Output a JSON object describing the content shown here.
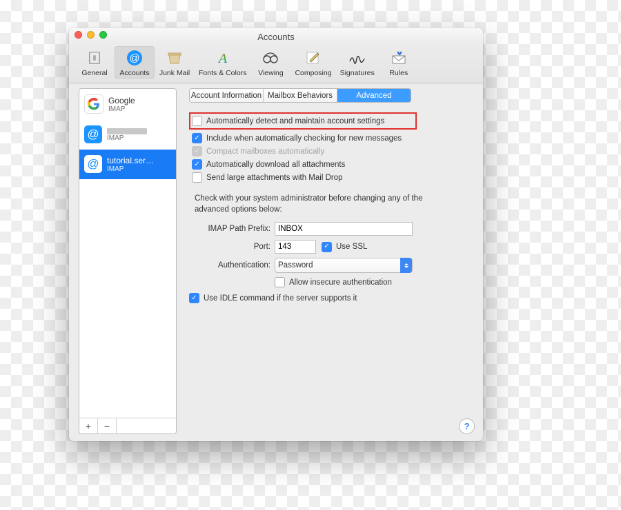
{
  "window": {
    "title": "Accounts"
  },
  "toolbar": {
    "items": [
      {
        "label": "General"
      },
      {
        "label": "Accounts"
      },
      {
        "label": "Junk Mail"
      },
      {
        "label": "Fonts & Colors"
      },
      {
        "label": "Viewing"
      },
      {
        "label": "Composing"
      },
      {
        "label": "Signatures"
      },
      {
        "label": "Rules"
      }
    ]
  },
  "sidebar": {
    "accounts": [
      {
        "name": "Google",
        "sub": "IMAP"
      },
      {
        "name": "",
        "sub": "IMAP"
      },
      {
        "name": "tutorial.ser…",
        "sub": "IMAP"
      }
    ],
    "add": "+",
    "remove": "−"
  },
  "tabs": {
    "t0": "Account Information",
    "t1": "Mailbox Behaviors",
    "t2": "Advanced"
  },
  "settings": {
    "auto_detect": "Automatically detect and maintain account settings",
    "include_check": "Include when automatically checking for new messages",
    "compact": "Compact mailboxes automatically",
    "download_attach": "Automatically download all attachments",
    "maildrop": "Send large attachments with Mail Drop",
    "admin_note": "Check with your system administrator before changing any of the advanced options below:",
    "imap_prefix_label": "IMAP Path Prefix:",
    "imap_prefix_value": "INBOX",
    "port_label": "Port:",
    "port_value": "143",
    "use_ssl": "Use SSL",
    "auth_label": "Authentication:",
    "auth_value": "Password",
    "allow_insecure": "Allow insecure authentication",
    "use_idle": "Use IDLE command if the server supports it"
  },
  "help": "?"
}
